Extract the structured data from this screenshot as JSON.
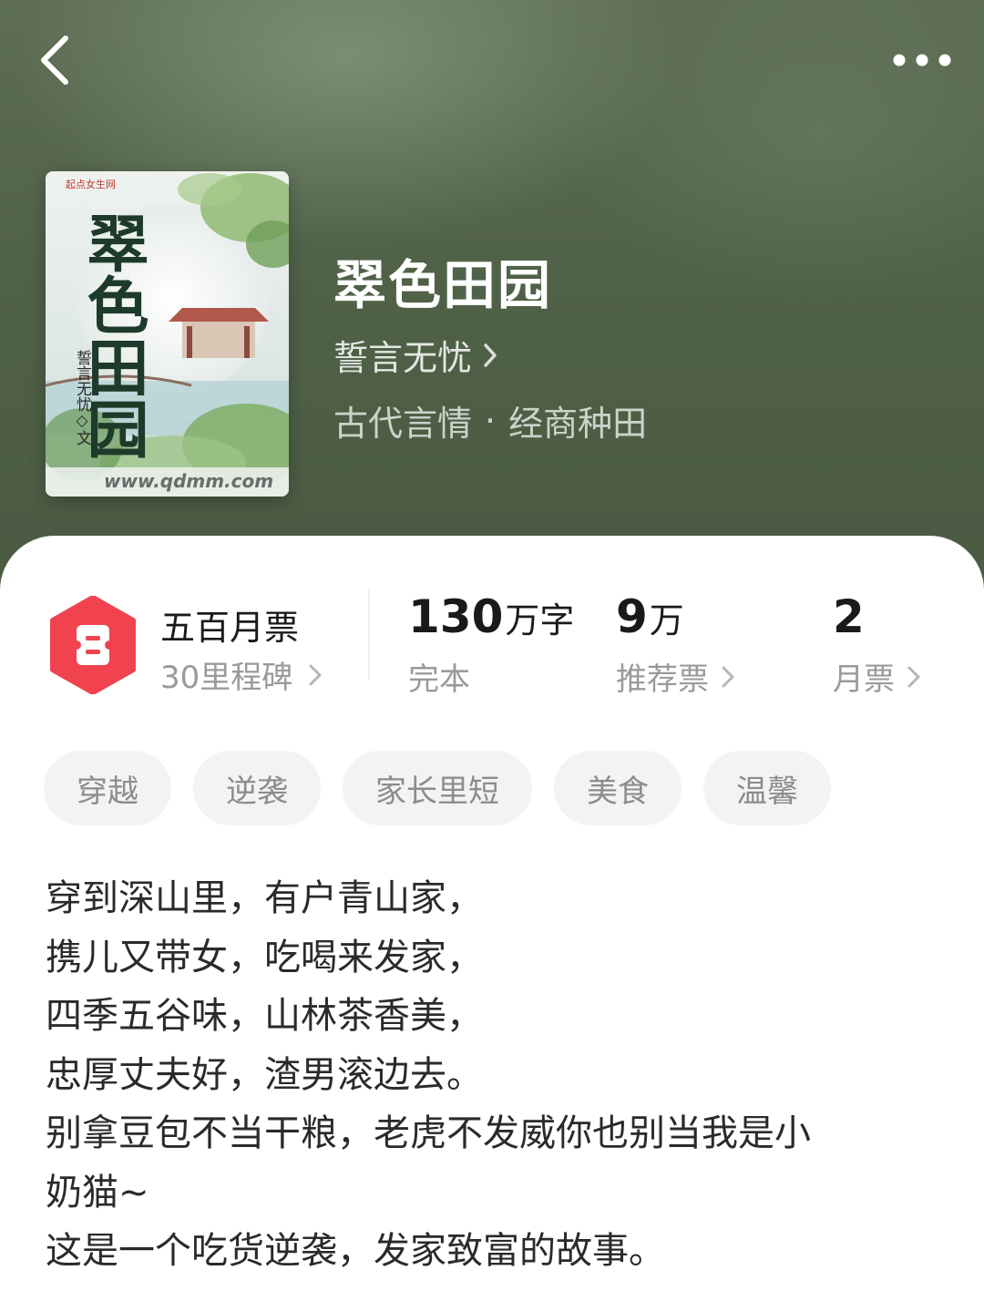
{
  "header": {
    "back_icon": "chevron-left-icon",
    "more_icon": "more-dots-icon"
  },
  "book": {
    "title": "翠色田园",
    "author": "誓言无忧",
    "genre_main": "古代言情",
    "genre_separator": "·",
    "genre_sub": "经商种田",
    "cover": {
      "title_text": "翠色田园",
      "author_text": "誓言无忧◇文",
      "publisher_text": "起点女生网",
      "url_text": "www.qdmm.com"
    }
  },
  "stats": {
    "milestone_title": "五百月票",
    "milestone_sub": "30里程碑",
    "word_count_value": "130",
    "word_count_unit": "万字",
    "word_count_label": "完本",
    "recommend_value": "9",
    "recommend_unit": "万",
    "recommend_label": "推荐票",
    "monthly_value": "2",
    "monthly_label": "月票"
  },
  "tags": [
    "穿越",
    "逆袭",
    "家长里短",
    "美食",
    "温馨"
  ],
  "description": [
    "穿到深山里，有户青山家，",
    "携儿又带女，吃喝来发家，",
    "四季五谷味，山林茶香美，",
    "忠厚丈夫好，渣男滚边去。",
    "别拿豆包不当干粮，老虎不发威你也别当我是小",
    "奶猫~",
    "这是一个吃货逆袭，发家致富的故事。"
  ],
  "colors": {
    "hero_bg": "#4f6147",
    "badge_red": "#f0434f",
    "text_dark": "#1a1a1a",
    "text_grey": "#9a9a9a",
    "tag_bg": "#f3f3f3"
  }
}
